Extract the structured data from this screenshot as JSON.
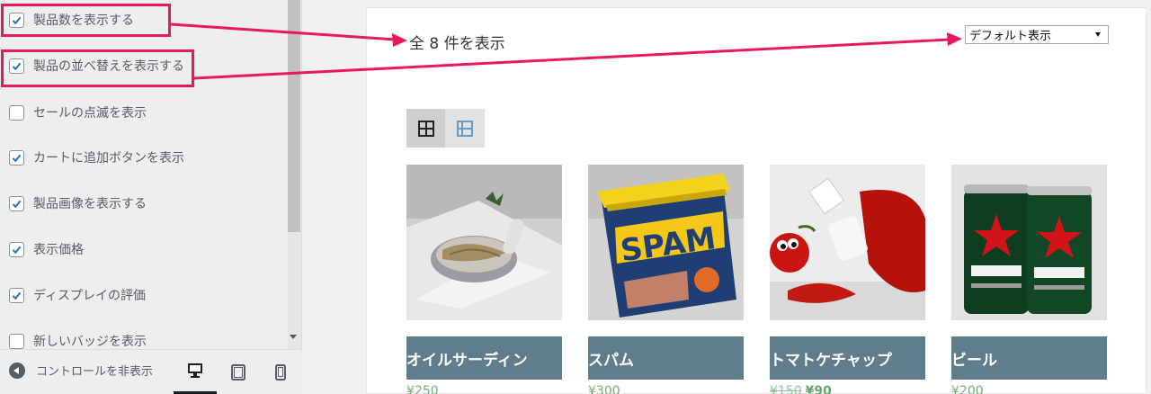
{
  "sidebar": {
    "options": [
      {
        "label": "製品数を表示する",
        "checked": true
      },
      {
        "label": "製品の並べ替えを表示する",
        "checked": true
      },
      {
        "label": "セールの点滅を表示",
        "checked": false
      },
      {
        "label": "カートに追加ボタンを表示",
        "checked": true
      },
      {
        "label": "製品画像を表示する",
        "checked": true
      },
      {
        "label": "表示価格",
        "checked": true
      },
      {
        "label": "ディスプレイの評価",
        "checked": true
      },
      {
        "label": "新しいバッジを表示",
        "checked": false
      }
    ],
    "footer": {
      "collapse_label": "コントロールを非表示",
      "devices": [
        "desktop-icon",
        "tablet-icon",
        "mobile-icon"
      ]
    }
  },
  "shop": {
    "result_count": "全 8 件を表示",
    "sort_selected": "デフォルト表示",
    "view_modes": [
      "grid-view-icon",
      "list-view-icon"
    ],
    "products": [
      {
        "title": "オイルサーディン",
        "price": "¥250",
        "old_price": "",
        "sale_price": ""
      },
      {
        "title": "スパム",
        "price": "¥300",
        "old_price": "",
        "sale_price": ""
      },
      {
        "title": "トマトケチャップ",
        "price": "",
        "old_price": "¥150",
        "sale_price": "¥90"
      },
      {
        "title": "ビール",
        "price": "¥200",
        "old_price": "",
        "sale_price": ""
      }
    ]
  },
  "colors": {
    "accent": "#e8195a",
    "product_title_bg": "#607d8b",
    "price": "#73a97b",
    "checkbox_blue": "#2271b1"
  }
}
